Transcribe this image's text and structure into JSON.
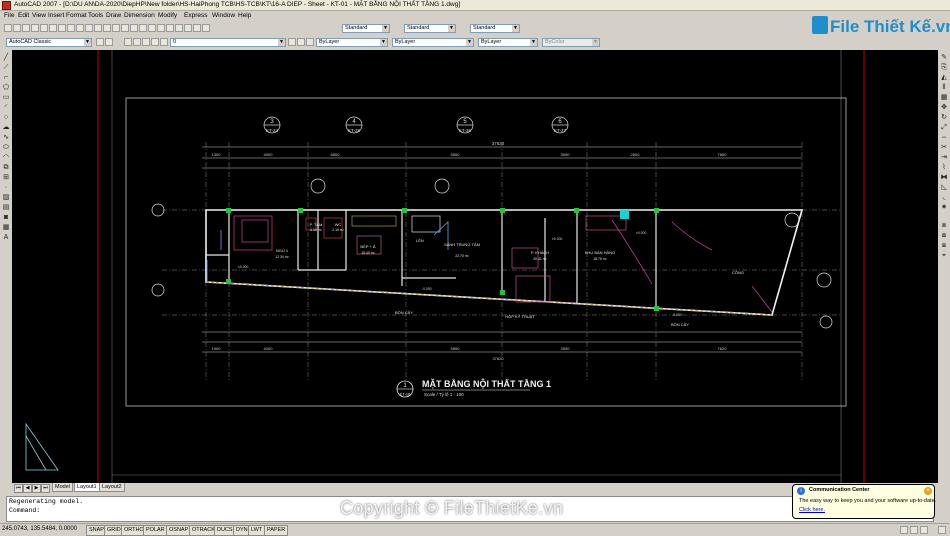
{
  "window": {
    "title": "AutoCAD 2007 - [D:\\DU AN\\DA-2020\\DiepHP\\New folder\\HS-HaiPhong TCB\\HS-TCB\\KT\\16-A DIEP - Sheet - KT-01 - MẶT BẰNG NỘI THẤT TẦNG 1.dwg]"
  },
  "menu": [
    "File",
    "Edit",
    "View",
    "Insert",
    "Format",
    "Tools",
    "Draw",
    "Dimension",
    "Modify",
    "Express",
    "Window",
    "Help"
  ],
  "toolbar": {
    "text_style": "Standard",
    "dim_style": "Standard",
    "table_style": "Standard",
    "workspace": "AutoCAD Classic",
    "layer": "0",
    "color": "ByLayer",
    "linetype": "ByLayer",
    "lineweight": "ByLayer",
    "plotstyle": "ByColor"
  },
  "logo": {
    "text": "File Thiết Kế.vn"
  },
  "drawing": {
    "plan_title": "MẶT BẰNG NỘI THẤT TẦNG 1",
    "scale_label": "Scale / Tỷ lệ 1 : 100",
    "ref_number": "1",
    "ref_sheet": "KT-16",
    "overall_dim": "37620",
    "section_marks": [
      {
        "num": "3",
        "sheet": "KT-24"
      },
      {
        "num": "4",
        "sheet": "KT-28"
      },
      {
        "num": "5",
        "sheet": "KT-26"
      },
      {
        "num": "6",
        "sheet": "KT-27"
      }
    ],
    "top_dims": [
      "1300",
      "4000",
      "6800",
      "5850",
      "3500",
      "2600",
      "7650"
    ],
    "bottom_dims": [
      "1900",
      "4000",
      "5850",
      "3500",
      "7620"
    ],
    "room_labels": [
      "NGỦ 1",
      "P. TẮM",
      "WC",
      "BẾP + Ă",
      "SẢNH TRUNG TÂM",
      "P. KHÁCH",
      "KHU BÁN HÀNG",
      "CÔNG",
      "BỒN CÂY",
      "HỘP KỸ THUẬT",
      "BỒN CÂY"
    ],
    "areas": [
      "12.34 m²",
      "5.06 m²",
      "2.16 m²",
      "18.40 m²",
      "22.70 m²",
      "30.41 m²",
      "18.75 m²"
    ],
    "level_labels": [
      "±0.000",
      "-0.050",
      "±0.000",
      "±0.000",
      "-0.050"
    ],
    "lift_label": "LÊN"
  },
  "tabs": [
    "Model",
    "Layout1",
    "Layout2"
  ],
  "command": {
    "line1": "Regenerating model.",
    "line2": "Command:"
  },
  "status": {
    "coords": "245.0743, 135.5484, 0.0000",
    "buttons": [
      "SNAP",
      "GRID",
      "ORTHO",
      "POLAR",
      "OSNAP",
      "OTRACK",
      "DUCS",
      "DYN",
      "LWT",
      "PAPER"
    ]
  },
  "balloon": {
    "title": "Communication Center",
    "text": "The easy way to keep you and your software up-to-date.",
    "link": "Click here."
  },
  "watermark": "Copyright © FileThietKe.vn",
  "colors": {
    "canvas": "#000000",
    "accent": "#1e8ecc",
    "plot_frame": "#c00000"
  }
}
